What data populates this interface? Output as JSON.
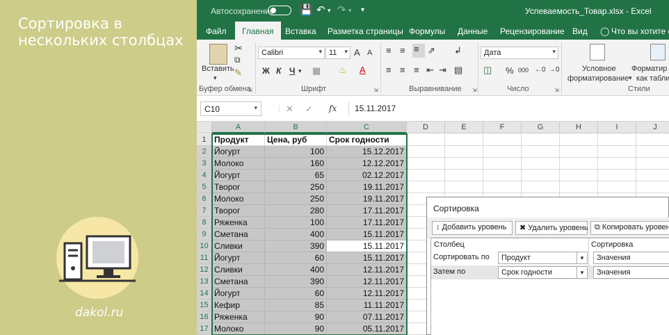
{
  "left": {
    "title": "Сортировка в нескольких столбцах",
    "site": "dakol.ru"
  },
  "titlebar": {
    "autosave": "Автосохранение",
    "doc_title": "Успеваемость_Товар.xlsx  -  Excel"
  },
  "menu": {
    "tabs": [
      "Файл",
      "Главная",
      "Вставка",
      "Разметка страницы",
      "Формулы",
      "Данные",
      "Рецензирование",
      "Вид"
    ],
    "tell_me": "Что вы хотите сде"
  },
  "ribbon": {
    "paste_label": "Вставить",
    "font_name": "Calibri",
    "font_size": "11",
    "bold": "Ж",
    "italic": "К",
    "underline": "Ч",
    "font_grow": "A",
    "font_shrink": "A",
    "number_format": "Дата",
    "percent": "%",
    "thousands": "000",
    "cond_format_1": "Условное",
    "cond_format_2": "форматирование",
    "format_table_1": "Форматир",
    "format_table_2": "как табли",
    "groups": {
      "clipboard": "Буфер обмена",
      "font": "Шрифт",
      "alignment": "Выравнивание",
      "number": "Число",
      "styles": "Стили"
    }
  },
  "formula_bar": {
    "name_box": "C10",
    "fx": "fx",
    "value": "15.11.2017"
  },
  "grid": {
    "columns": [
      "A",
      "B",
      "C",
      "D",
      "E",
      "F",
      "G",
      "H",
      "I",
      "J"
    ],
    "rows": [
      [
        "Продукт",
        "Цена, руб",
        "Срок годности"
      ],
      [
        "Йогурт",
        "100",
        "15.12.2017"
      ],
      [
        "Молоко",
        "160",
        "12.12.2017"
      ],
      [
        "Йогурт",
        "65",
        "02.12.2017"
      ],
      [
        "Творог",
        "250",
        "19.11.2017"
      ],
      [
        "Молоко",
        "250",
        "19.11.2017"
      ],
      [
        "Творог",
        "280",
        "17.11.2017"
      ],
      [
        "Ряженка",
        "100",
        "17.11.2017"
      ],
      [
        "Сметана",
        "400",
        "15.11.2017"
      ],
      [
        "Сливки",
        "390",
        "15.11.2017"
      ],
      [
        "Йогурт",
        "60",
        "15.11.2017"
      ],
      [
        "Сливки",
        "400",
        "12.11.2017"
      ],
      [
        "Сметана",
        "390",
        "12.11.2017"
      ],
      [
        "Йогурт",
        "60",
        "12.11.2017"
      ],
      [
        "Кефир",
        "85",
        "11.11.2017"
      ],
      [
        "Ряженка",
        "90",
        "07.11.2017"
      ],
      [
        "Молоко",
        "90",
        "05.11.2017"
      ]
    ]
  },
  "dialog": {
    "title": "Сортировка",
    "add_level": "Добавить уровень",
    "delete_level": "Удалить уровень",
    "copy_level": "Копировать уровен",
    "col_header": "Столбец",
    "sort_header": "Сортировка",
    "levels": [
      {
        "label": "Сортировать по",
        "column": "Продукт",
        "sort_on": "Значения"
      },
      {
        "label": "Затем по",
        "column": "Срок годности",
        "sort_on": "Значения"
      }
    ]
  },
  "colors": {
    "excel_green": "#217346",
    "left_panel": "#cdcc89",
    "selection_fill": "#c7c7c7"
  }
}
